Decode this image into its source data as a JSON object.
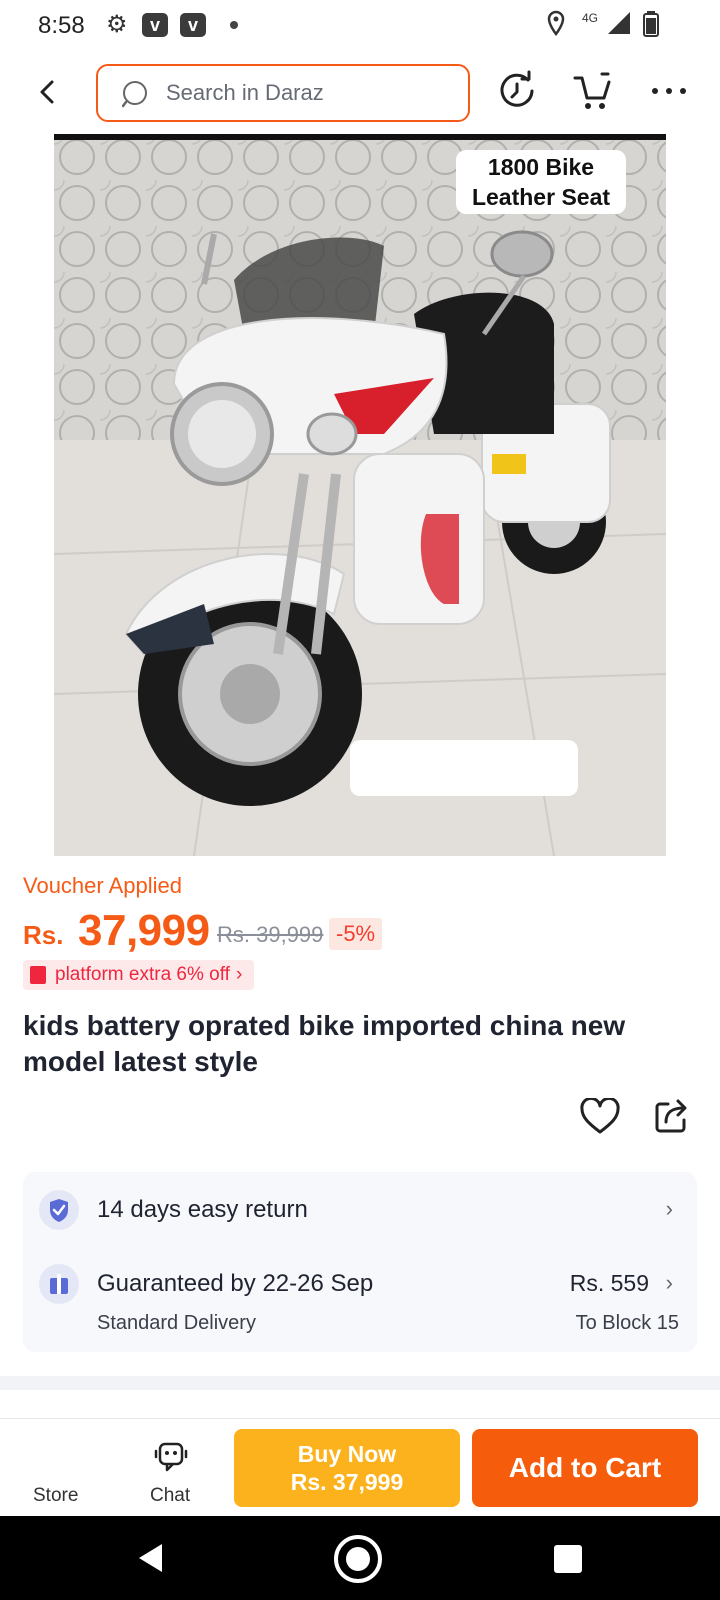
{
  "status_bar": {
    "time": "8:58",
    "network": "4G",
    "icons": [
      "gear-icon",
      "v-app-icon",
      "v-app-icon",
      "dot-icon",
      "location-icon",
      "signal-icon",
      "battery-icon"
    ]
  },
  "header": {
    "search_placeholder": "Search in Daraz",
    "icons": [
      "back-icon",
      "search-icon",
      "history-icon",
      "cart-icon",
      "more-icon"
    ]
  },
  "product": {
    "image_tag_line1": "1800 Bike",
    "image_tag_line2": "Leather Seat",
    "voucher_label": "Voucher Applied",
    "price_currency": "Rs.",
    "price_value": "37,999",
    "original_price": "Rs. 39,999",
    "discount": "-5%",
    "promo_text": "platform extra 6% off",
    "title": "kids battery oprated bike imported china new model latest style"
  },
  "services": {
    "return_text": "14 days easy return",
    "delivery_guarantee": "Guaranteed by 22-26 Sep",
    "delivery_type": "Standard Delivery",
    "delivery_price": "Rs. 559",
    "delivery_location": "To Block 15"
  },
  "bottom_bar": {
    "store_label": "Store",
    "chat_label": "Chat",
    "buy_now_label": "Buy Now",
    "buy_now_price": "Rs. 37,999",
    "add_to_cart_label": "Add to Cart"
  },
  "colors": {
    "accent": "#f55b16",
    "buy_now": "#fcb21c",
    "add_to_cart": "#f55d0d",
    "promo": "#f0263f"
  }
}
